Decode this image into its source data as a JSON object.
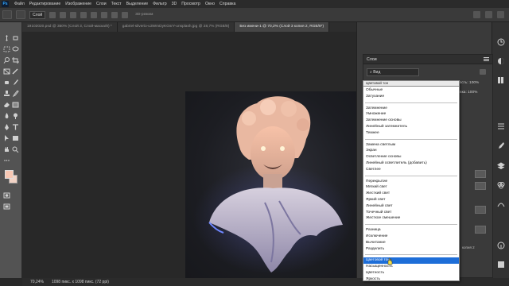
{
  "app": {
    "logo": "Ps"
  },
  "menu": [
    "Файл",
    "Редактирование",
    "Изображение",
    "Слои",
    "Текст",
    "Выделение",
    "Фильтр",
    "3D",
    "Просмотр",
    "Окно",
    "Справка"
  ],
  "options_bar": {
    "target_label": "Слой",
    "mode_3d_label": "3D-режим"
  },
  "tabs": [
    {
      "label": "19102020.psd @ 350% (Слой 3, Слой-маска/8) *",
      "active": false
    },
    {
      "label": "gabriel-silverio-u3WmDyKGsrY-unsplash.jpg @ 28,7% (RGB/8)",
      "active": false
    },
    {
      "label": "Без имени-1 @ 70,2% (Слой 3 копия 2, RGB/8*)",
      "active": true
    }
  ],
  "status": {
    "zoom": "70,24%",
    "doc_size": "1098 пикс. x 1098 пикс. (72 ppi)"
  },
  "colors": {
    "foreground": "#f7c7b3",
    "background": "#f2d3c5",
    "accent": "#1e6ed8"
  },
  "layers_panel": {
    "title": "Слои",
    "filter_label": "Вид",
    "blend_mode_current": "Цветовой тон",
    "opacity_label": "Непрозрачность:",
    "opacity_value": "100%",
    "fill_label": "Заливка:",
    "fill_value": "100%",
    "layer_name_fragment": "копия 2",
    "blend_modes": [
      [
        "Обычные",
        "Затухание"
      ],
      [
        "Затемнение",
        "Умножение",
        "Затемнение основы",
        "Линейный затемнитель",
        "Темнее"
      ],
      [
        "Замена светлым",
        "Экран",
        "Осветление основы",
        "Линейный осветлитель (добавить)",
        "Светлее"
      ],
      [
        "Перекрытие",
        "Мягкий свет",
        "Жесткий свет",
        "Яркий свет",
        "Линейный свет",
        "Точечный свет",
        "Жесткое смешение"
      ],
      [
        "Разница",
        "Исключение",
        "Вычитание",
        "Разделить"
      ],
      [
        "Цветовой тон",
        "Насыщенность",
        "Цветность",
        "Яркость"
      ]
    ],
    "selected_mode": "Цветовой тон"
  },
  "tool_icons": [
    "move-icon",
    "artboard-icon",
    "marquee-icon",
    "lasso-icon",
    "quick-select-icon",
    "crop-icon",
    "frame-icon",
    "eyedropper-icon",
    "healing-icon",
    "brush-icon",
    "stamp-icon",
    "history-brush-icon",
    "eraser-icon",
    "gradient-icon",
    "blur-icon",
    "dodge-icon",
    "pen-icon",
    "type-icon",
    "path-select-icon",
    "rectangle-icon",
    "hand-icon",
    "zoom-icon"
  ],
  "panel_icons": [
    "history-icon",
    "adjustments-icon",
    "libraries-icon",
    "properties-icon",
    "brushes-icon",
    "layers-icon",
    "channels-icon",
    "paths-icon",
    "info-icon",
    "color-icon"
  ]
}
